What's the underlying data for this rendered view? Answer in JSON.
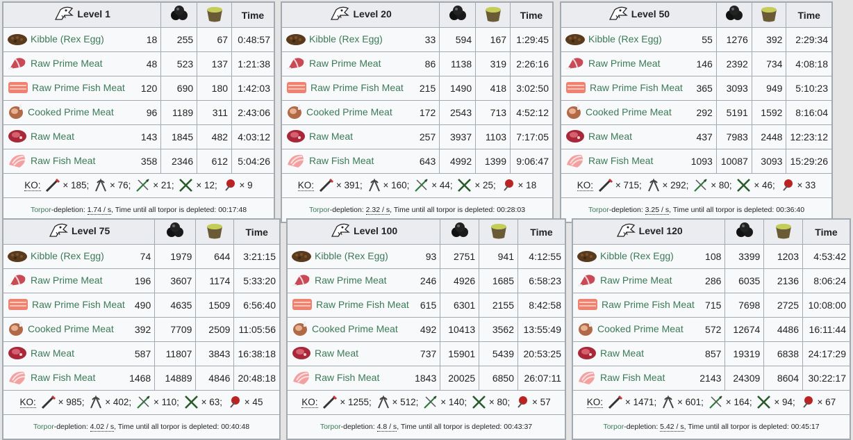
{
  "headers": {
    "time": "Time"
  },
  "labels": {
    "ko": "KO:",
    "torpor": "Torpor",
    "depletion": "-depletion: ",
    "per_sec_suffix": " / s",
    "until": ", Time until all torpor is depleted: "
  },
  "foods": [
    "Kibble (Rex Egg)",
    "Raw Prime Meat",
    "Raw Prime Fish Meat",
    "Cooked Prime Meat",
    "Raw Meat",
    "Raw Fish Meat"
  ],
  "tables": [
    {
      "level": "Level 1",
      "rows": [
        [
          "18",
          "255",
          "67",
          "0:48:57"
        ],
        [
          "48",
          "523",
          "137",
          "1:21:38"
        ],
        [
          "120",
          "690",
          "180",
          "1:42:03"
        ],
        [
          "96",
          "1189",
          "311",
          "2:43:06"
        ],
        [
          "143",
          "1845",
          "482",
          "4:03:12"
        ],
        [
          "358",
          "2346",
          "612",
          "5:04:26"
        ]
      ],
      "ko": [
        "× 185;",
        "× 76;",
        "× 21;",
        "× 12;",
        "× 9"
      ],
      "rate": "1.74",
      "deplete": "00:17:48"
    },
    {
      "level": "Level 20",
      "rows": [
        [
          "33",
          "594",
          "167",
          "1:29:45"
        ],
        [
          "86",
          "1138",
          "319",
          "2:26:16"
        ],
        [
          "215",
          "1490",
          "418",
          "3:02:50"
        ],
        [
          "172",
          "2543",
          "713",
          "4:52:12"
        ],
        [
          "257",
          "3937",
          "1103",
          "7:17:05"
        ],
        [
          "643",
          "4992",
          "1399",
          "9:06:47"
        ]
      ],
      "ko": [
        "× 391;",
        "× 160;",
        "× 44;",
        "× 25;",
        "× 18"
      ],
      "rate": "2.32",
      "deplete": "00:28:03"
    },
    {
      "level": "Level 50",
      "rows": [
        [
          "55",
          "1276",
          "392",
          "2:29:34"
        ],
        [
          "146",
          "2392",
          "734",
          "4:08:18"
        ],
        [
          "365",
          "3093",
          "949",
          "5:10:23"
        ],
        [
          "292",
          "5191",
          "1592",
          "8:16:04"
        ],
        [
          "437",
          "7983",
          "2448",
          "12:23:12"
        ],
        [
          "1093",
          "10087",
          "3093",
          "15:29:26"
        ]
      ],
      "ko": [
        "× 715;",
        "× 292;",
        "× 80;",
        "× 46;",
        "× 33"
      ],
      "rate": "3.25",
      "deplete": "00:36:40"
    },
    {
      "level": "Level 75",
      "rows": [
        [
          "74",
          "1979",
          "644",
          "3:21:15"
        ],
        [
          "196",
          "3607",
          "1174",
          "5:33:20"
        ],
        [
          "490",
          "4635",
          "1509",
          "6:56:40"
        ],
        [
          "392",
          "7709",
          "2509",
          "11:05:56"
        ],
        [
          "587",
          "11807",
          "3843",
          "16:38:18"
        ],
        [
          "1468",
          "14889",
          "4846",
          "20:48:18"
        ]
      ],
      "ko": [
        "× 985;",
        "× 402;",
        "× 110;",
        "× 63;",
        "× 45"
      ],
      "rate": "4.02",
      "deplete": "00:40:48"
    },
    {
      "level": "Level 100",
      "rows": [
        [
          "93",
          "2751",
          "941",
          "4:12:55"
        ],
        [
          "246",
          "4926",
          "1685",
          "6:58:23"
        ],
        [
          "615",
          "6301",
          "2155",
          "8:42:58"
        ],
        [
          "492",
          "10413",
          "3562",
          "13:55:49"
        ],
        [
          "737",
          "15901",
          "5439",
          "20:53:25"
        ],
        [
          "1843",
          "20025",
          "6850",
          "26:07:11"
        ]
      ],
      "ko": [
        "× 1255;",
        "× 512;",
        "× 140;",
        "× 80;",
        "× 57"
      ],
      "rate": "4.8",
      "deplete": "00:43:37"
    },
    {
      "level": "Level 120",
      "rows": [
        [
          "108",
          "3399",
          "1203",
          "4:53:42"
        ],
        [
          "286",
          "6035",
          "2136",
          "8:06:24"
        ],
        [
          "715",
          "7698",
          "2725",
          "10:08:00"
        ],
        [
          "572",
          "12674",
          "4486",
          "16:11:44"
        ],
        [
          "857",
          "19319",
          "6838",
          "24:17:29"
        ],
        [
          "2143",
          "24309",
          "8604",
          "30:22:17"
        ]
      ],
      "ko": [
        "× 1471;",
        "× 601;",
        "× 164;",
        "× 94;",
        "× 67"
      ],
      "rate": "5.42",
      "deplete": "00:45:17"
    }
  ],
  "icons": {
    "taming": "rex-skull-icon",
    "narcoberry": "narcoberry-icon",
    "narcotic": "narcotic-bowl-icon"
  },
  "colors": {
    "link": "#3b7a57",
    "border": "#a2a9b1",
    "header_bg": "#eaecf0",
    "cell_bg": "#f8f9fa"
  }
}
